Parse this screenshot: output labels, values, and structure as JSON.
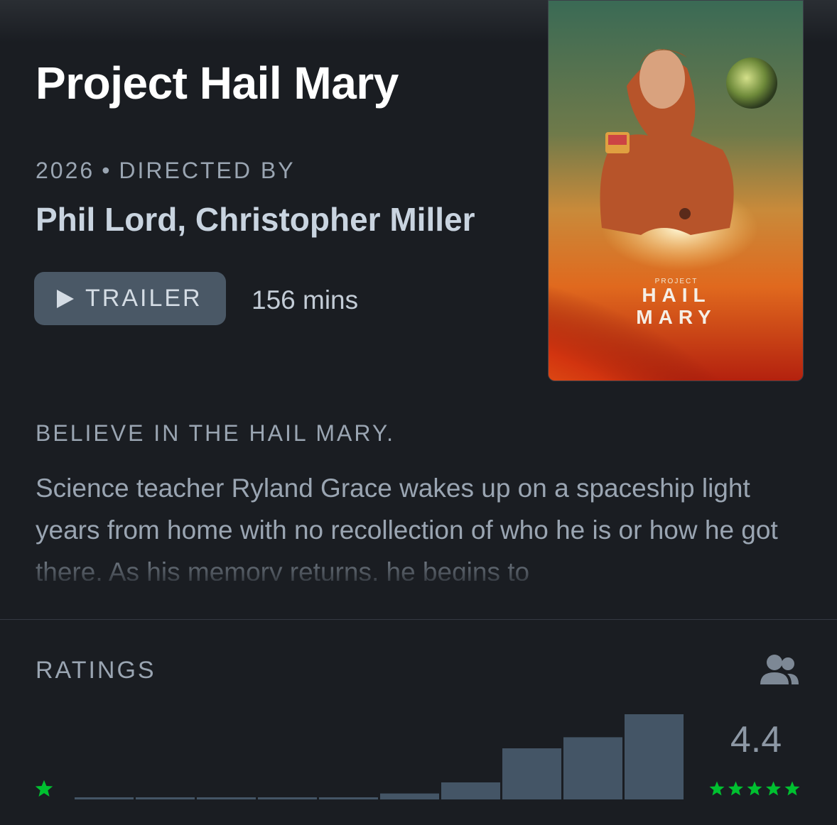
{
  "film": {
    "title": "Project Hail Mary",
    "year": "2026",
    "separator": "•",
    "directed_by_label": "DIRECTED BY",
    "directors": "Phil Lord, Christopher Miller",
    "trailer_label": "TRAILER",
    "runtime": "156 mins",
    "poster": {
      "small_title": "PROJECT",
      "line1": "HAIL",
      "line2": "MARY"
    },
    "tagline": "BELIEVE IN THE HAIL MARY.",
    "synopsis": "Science teacher Ryland Grace wakes up on a spaceship light years from home with no recollection of who he is or how he got there. As his memory returns, he begins to"
  },
  "ratings": {
    "label": "RATINGS",
    "average": "4.4",
    "star_color": "#00c030",
    "bar_color": "#445566",
    "icons": [
      "people-icon",
      "star-icon"
    ],
    "histogram": [
      0.0,
      0.0,
      0.0,
      0.0,
      0.0,
      0.07,
      0.2,
      0.6,
      0.73,
      1.0
    ]
  }
}
